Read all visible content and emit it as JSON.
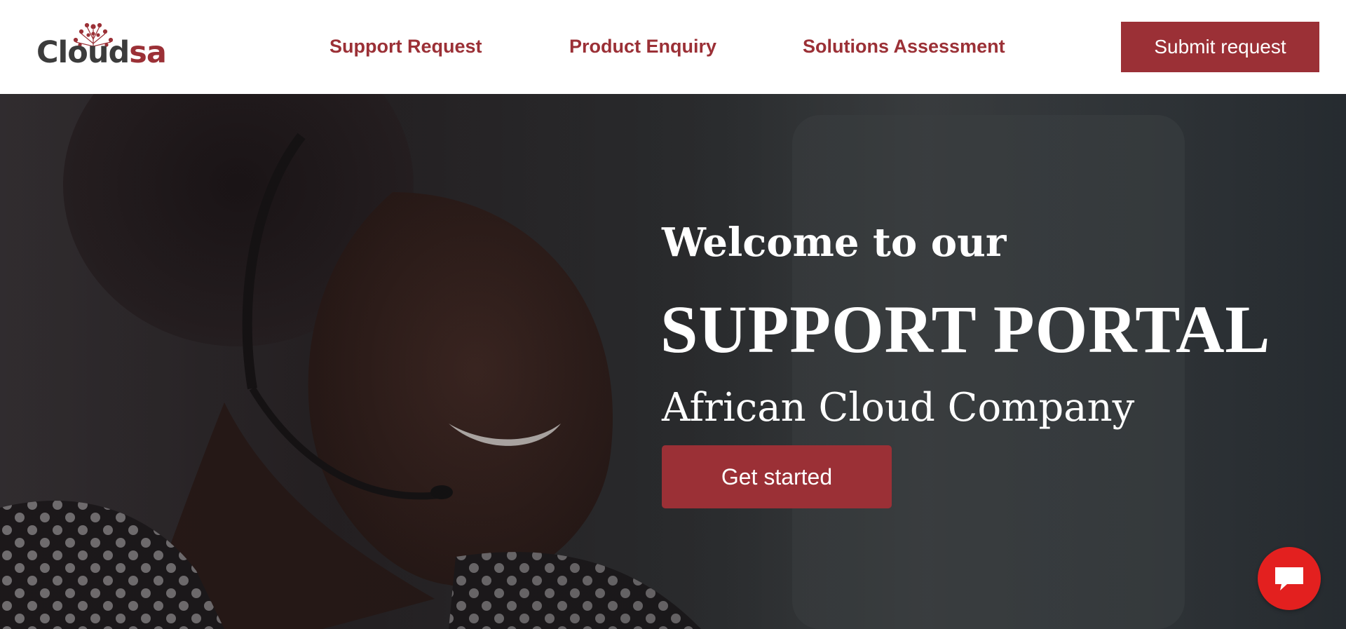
{
  "header": {
    "logo": {
      "part1": "Cloud",
      "part2": "sa"
    },
    "nav": [
      {
        "label": "Support Request"
      },
      {
        "label": "Product Enquiry"
      },
      {
        "label": "Solutions Assessment"
      }
    ],
    "submit_label": "Submit request"
  },
  "hero": {
    "welcome": "Welcome to our",
    "title": "SUPPORT PORTAL",
    "subtitle": "African Cloud Company",
    "cta_label": "Get started"
  },
  "chat": {
    "icon": "chat-bubble-icon"
  },
  "colors": {
    "brand": "#9b3036",
    "chat": "#e3201f",
    "logo_dark": "#3c3c3c"
  }
}
